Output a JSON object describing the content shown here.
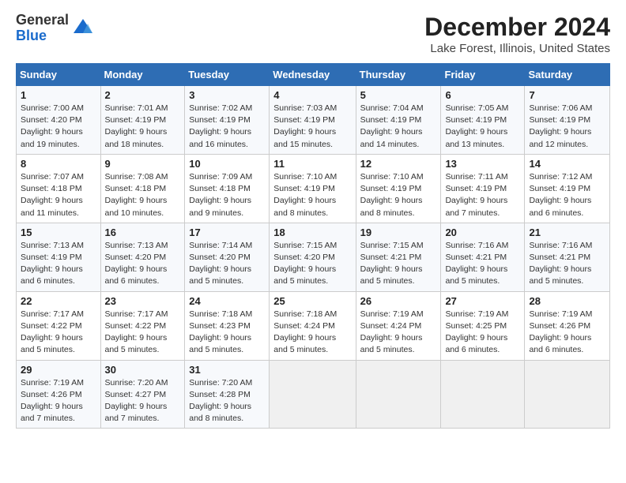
{
  "header": {
    "logo_line1": "General",
    "logo_line2": "Blue",
    "title": "December 2024",
    "subtitle": "Lake Forest, Illinois, United States"
  },
  "calendar": {
    "days_of_week": [
      "Sunday",
      "Monday",
      "Tuesday",
      "Wednesday",
      "Thursday",
      "Friday",
      "Saturday"
    ],
    "weeks": [
      [
        {
          "day": "1",
          "info": "Sunrise: 7:00 AM\nSunset: 4:20 PM\nDaylight: 9 hours\nand 19 minutes."
        },
        {
          "day": "2",
          "info": "Sunrise: 7:01 AM\nSunset: 4:19 PM\nDaylight: 9 hours\nand 18 minutes."
        },
        {
          "day": "3",
          "info": "Sunrise: 7:02 AM\nSunset: 4:19 PM\nDaylight: 9 hours\nand 16 minutes."
        },
        {
          "day": "4",
          "info": "Sunrise: 7:03 AM\nSunset: 4:19 PM\nDaylight: 9 hours\nand 15 minutes."
        },
        {
          "day": "5",
          "info": "Sunrise: 7:04 AM\nSunset: 4:19 PM\nDaylight: 9 hours\nand 14 minutes."
        },
        {
          "day": "6",
          "info": "Sunrise: 7:05 AM\nSunset: 4:19 PM\nDaylight: 9 hours\nand 13 minutes."
        },
        {
          "day": "7",
          "info": "Sunrise: 7:06 AM\nSunset: 4:19 PM\nDaylight: 9 hours\nand 12 minutes."
        }
      ],
      [
        {
          "day": "8",
          "info": "Sunrise: 7:07 AM\nSunset: 4:18 PM\nDaylight: 9 hours\nand 11 minutes."
        },
        {
          "day": "9",
          "info": "Sunrise: 7:08 AM\nSunset: 4:18 PM\nDaylight: 9 hours\nand 10 minutes."
        },
        {
          "day": "10",
          "info": "Sunrise: 7:09 AM\nSunset: 4:18 PM\nDaylight: 9 hours\nand 9 minutes."
        },
        {
          "day": "11",
          "info": "Sunrise: 7:10 AM\nSunset: 4:19 PM\nDaylight: 9 hours\nand 8 minutes."
        },
        {
          "day": "12",
          "info": "Sunrise: 7:10 AM\nSunset: 4:19 PM\nDaylight: 9 hours\nand 8 minutes."
        },
        {
          "day": "13",
          "info": "Sunrise: 7:11 AM\nSunset: 4:19 PM\nDaylight: 9 hours\nand 7 minutes."
        },
        {
          "day": "14",
          "info": "Sunrise: 7:12 AM\nSunset: 4:19 PM\nDaylight: 9 hours\nand 6 minutes."
        }
      ],
      [
        {
          "day": "15",
          "info": "Sunrise: 7:13 AM\nSunset: 4:19 PM\nDaylight: 9 hours\nand 6 minutes."
        },
        {
          "day": "16",
          "info": "Sunrise: 7:13 AM\nSunset: 4:20 PM\nDaylight: 9 hours\nand 6 minutes."
        },
        {
          "day": "17",
          "info": "Sunrise: 7:14 AM\nSunset: 4:20 PM\nDaylight: 9 hours\nand 5 minutes."
        },
        {
          "day": "18",
          "info": "Sunrise: 7:15 AM\nSunset: 4:20 PM\nDaylight: 9 hours\nand 5 minutes."
        },
        {
          "day": "19",
          "info": "Sunrise: 7:15 AM\nSunset: 4:21 PM\nDaylight: 9 hours\nand 5 minutes."
        },
        {
          "day": "20",
          "info": "Sunrise: 7:16 AM\nSunset: 4:21 PM\nDaylight: 9 hours\nand 5 minutes."
        },
        {
          "day": "21",
          "info": "Sunrise: 7:16 AM\nSunset: 4:21 PM\nDaylight: 9 hours\nand 5 minutes."
        }
      ],
      [
        {
          "day": "22",
          "info": "Sunrise: 7:17 AM\nSunset: 4:22 PM\nDaylight: 9 hours\nand 5 minutes."
        },
        {
          "day": "23",
          "info": "Sunrise: 7:17 AM\nSunset: 4:22 PM\nDaylight: 9 hours\nand 5 minutes."
        },
        {
          "day": "24",
          "info": "Sunrise: 7:18 AM\nSunset: 4:23 PM\nDaylight: 9 hours\nand 5 minutes."
        },
        {
          "day": "25",
          "info": "Sunrise: 7:18 AM\nSunset: 4:24 PM\nDaylight: 9 hours\nand 5 minutes."
        },
        {
          "day": "26",
          "info": "Sunrise: 7:19 AM\nSunset: 4:24 PM\nDaylight: 9 hours\nand 5 minutes."
        },
        {
          "day": "27",
          "info": "Sunrise: 7:19 AM\nSunset: 4:25 PM\nDaylight: 9 hours\nand 6 minutes."
        },
        {
          "day": "28",
          "info": "Sunrise: 7:19 AM\nSunset: 4:26 PM\nDaylight: 9 hours\nand 6 minutes."
        }
      ],
      [
        {
          "day": "29",
          "info": "Sunrise: 7:19 AM\nSunset: 4:26 PM\nDaylight: 9 hours\nand 7 minutes."
        },
        {
          "day": "30",
          "info": "Sunrise: 7:20 AM\nSunset: 4:27 PM\nDaylight: 9 hours\nand 7 minutes."
        },
        {
          "day": "31",
          "info": "Sunrise: 7:20 AM\nSunset: 4:28 PM\nDaylight: 9 hours\nand 8 minutes."
        },
        null,
        null,
        null,
        null
      ]
    ]
  }
}
